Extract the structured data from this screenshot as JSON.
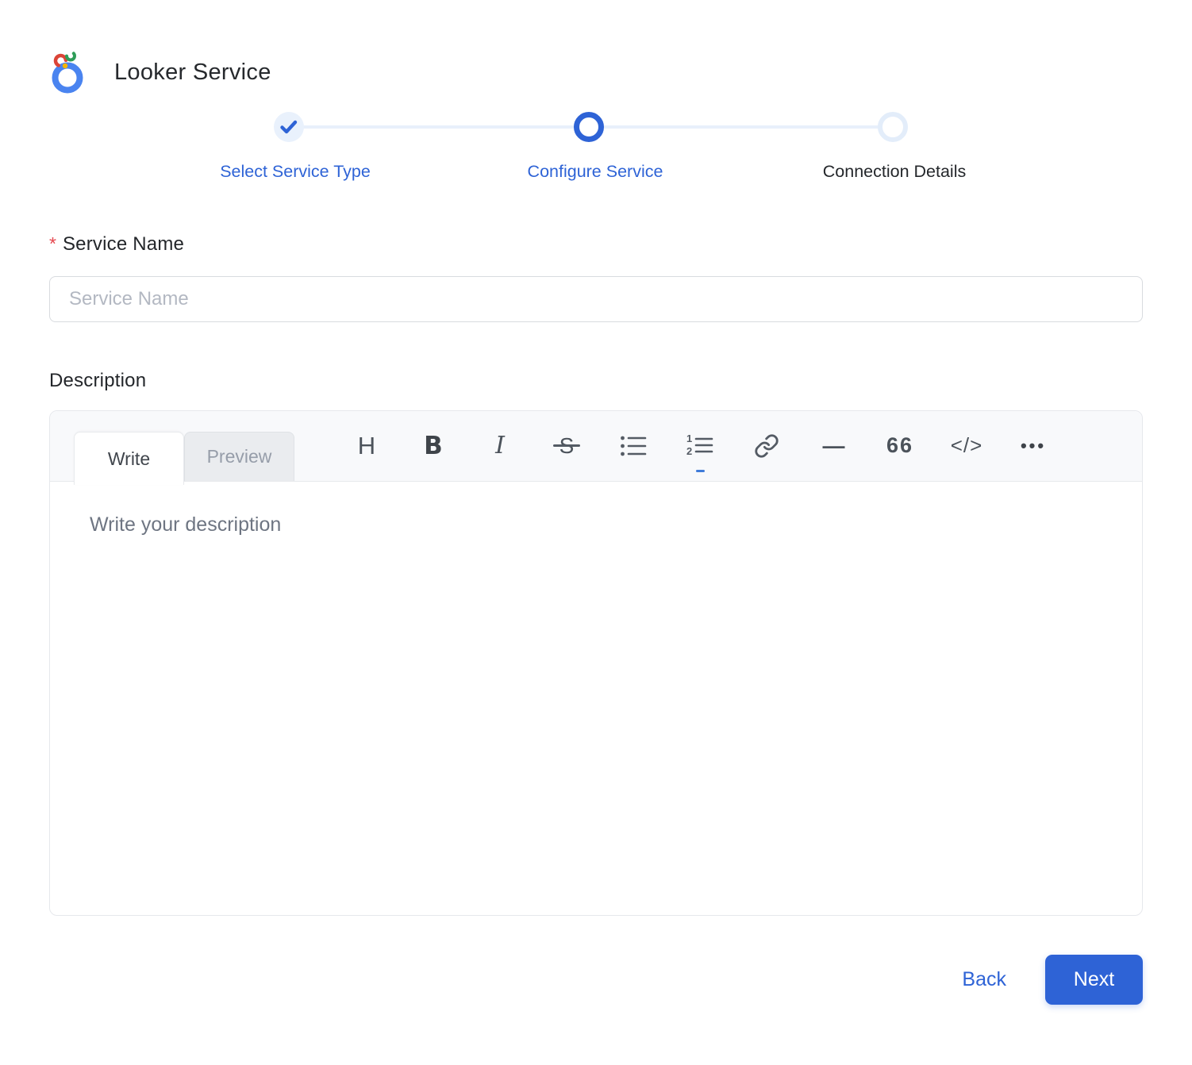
{
  "header": {
    "title": "Looker Service",
    "logo_name": "looker-logo"
  },
  "stepper": {
    "steps": [
      {
        "label": "Select Service Type",
        "state": "completed"
      },
      {
        "label": "Configure Service",
        "state": "current"
      },
      {
        "label": "Connection Details",
        "state": "upcoming"
      }
    ]
  },
  "form": {
    "service_name": {
      "label": "Service Name",
      "required_marker": "*",
      "placeholder": "Service Name",
      "value": ""
    },
    "description": {
      "label": "Description",
      "placeholder": "Write your description",
      "value": ""
    }
  },
  "editor": {
    "tabs": [
      {
        "label": "Write",
        "active": true
      },
      {
        "label": "Preview",
        "active": false
      }
    ],
    "toolbar": [
      {
        "name": "heading-icon",
        "glyph": "H"
      },
      {
        "name": "bold-icon",
        "glyph": "B"
      },
      {
        "name": "italic-icon",
        "glyph": "I"
      },
      {
        "name": "strikethrough-icon",
        "glyph": "S"
      },
      {
        "name": "unordered-list-icon",
        "glyph": ""
      },
      {
        "name": "ordered-list-icon",
        "glyph": ""
      },
      {
        "name": "link-icon",
        "glyph": ""
      },
      {
        "name": "horizontal-rule-icon",
        "glyph": "—"
      },
      {
        "name": "quote-icon",
        "glyph": "66"
      },
      {
        "name": "code-icon",
        "glyph": "</>"
      },
      {
        "name": "more-icon",
        "glyph": "•••"
      }
    ]
  },
  "footer": {
    "back_label": "Back",
    "next_label": "Next"
  },
  "colors": {
    "accent": "#2E63D6",
    "accent_light": "#E9F1FC",
    "required": "#E5484F",
    "toolbar_icon": "#545B64",
    "header_bg": "#F8F9FB"
  }
}
